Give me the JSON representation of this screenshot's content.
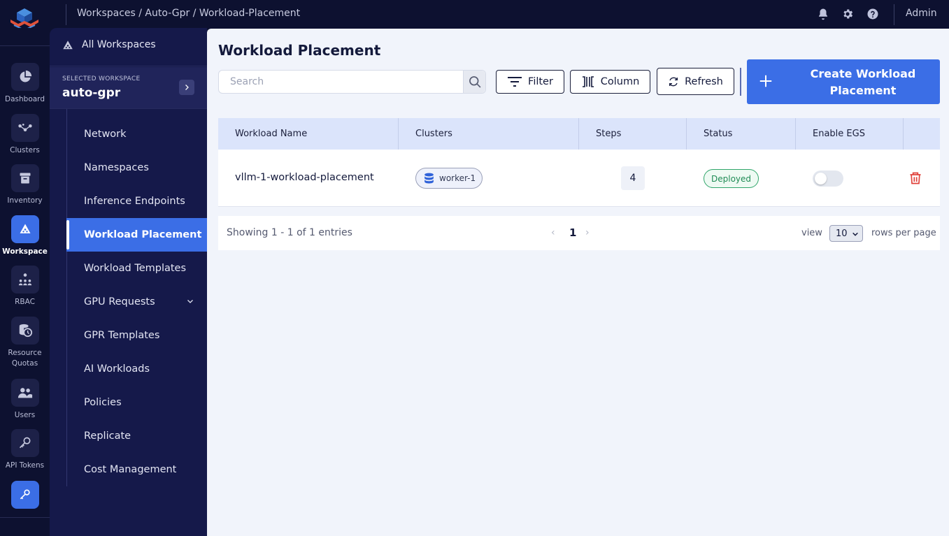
{
  "topbar": {
    "breadcrumb": "Workspaces / Auto-Gpr / Workload-Placement",
    "user": "Admin",
    "icons": [
      "bell-icon",
      "gear-icon",
      "help-icon"
    ]
  },
  "rail": {
    "items": [
      {
        "label": "Dashboard",
        "icon": "pie-chart-icon"
      },
      {
        "label": "Clusters",
        "icon": "network-nodes-icon"
      },
      {
        "label": "Inventory",
        "icon": "archive-box-icon"
      },
      {
        "label": "Workspace",
        "icon": "workspace-icon",
        "active": true
      },
      {
        "label": "RBAC",
        "icon": "org-users-icon"
      },
      {
        "label": "Resource Quotas",
        "icon": "database-clock-icon"
      },
      {
        "label": "Users",
        "icon": "users-icon"
      },
      {
        "label": "API Tokens",
        "icon": "key-icon"
      }
    ],
    "bottom_icon": "key-icon"
  },
  "workspace_sidebar": {
    "all_workspaces": "All Workspaces",
    "selected_caption": "SELECTED WORKSPACE",
    "selected_name": "auto-gpr",
    "items": [
      {
        "label": "Network"
      },
      {
        "label": "Namespaces"
      },
      {
        "label": "Inference Endpoints"
      },
      {
        "label": "Workload Placement",
        "active": true
      },
      {
        "label": "Workload Templates"
      },
      {
        "label": "GPU Requests",
        "expandable": true
      },
      {
        "label": "GPR Templates"
      },
      {
        "label": "AI Workloads"
      },
      {
        "label": "Policies"
      },
      {
        "label": "Replicate"
      },
      {
        "label": "Cost Management"
      }
    ]
  },
  "main": {
    "title": "Workload Placement",
    "search_placeholder": "Search",
    "filter_label": "Filter",
    "column_label": "Column",
    "refresh_label": "Refresh",
    "create_label": "Create Workload Placement",
    "table": {
      "headers": [
        "Workload Name",
        "Clusters",
        "Steps",
        "Status",
        "Enable EGS"
      ],
      "rows": [
        {
          "name": "vllm-1-workload-placement",
          "cluster": "worker-1",
          "steps": "4",
          "status": "Deployed",
          "enable_egs": false
        }
      ]
    },
    "pager": {
      "info": "Showing 1 - 1 of 1 entries",
      "prev": "‹",
      "page": "1",
      "next": "›",
      "view_label": "view",
      "rows_value": "10",
      "rows_label": "rows per page"
    }
  },
  "colors": {
    "accent": "#3b6ee6",
    "sidebar": "#15194a",
    "rail": "#0d1130",
    "status_green": "#1f8c55",
    "delete_red": "#e0403a"
  }
}
